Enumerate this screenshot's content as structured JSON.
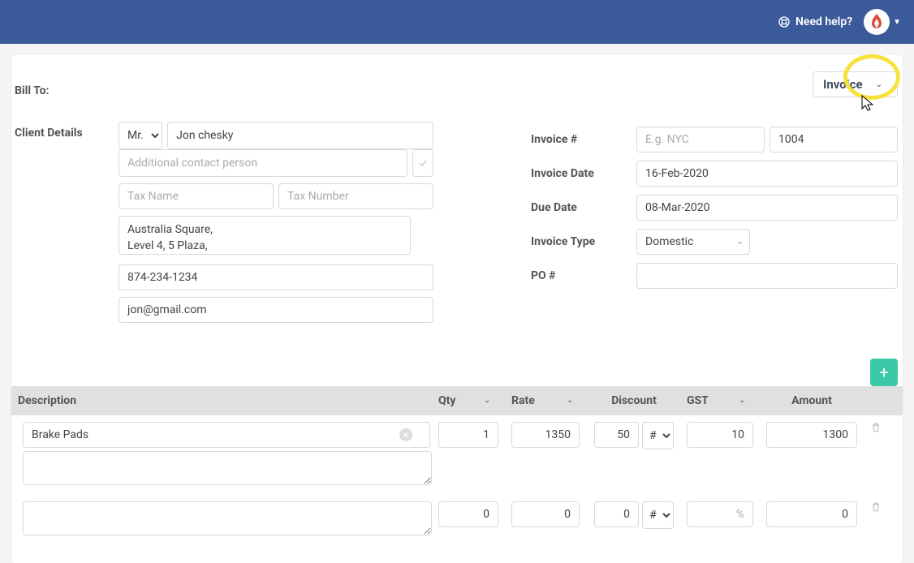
{
  "header": {
    "help_label": "Need help?"
  },
  "invoice_dropdown": {
    "label": "Invoice"
  },
  "labels": {
    "bill_to": "Bill To:",
    "client_details": "Client Details",
    "invoice_num": "Invoice #",
    "invoice_date": "Invoice Date",
    "due_date": "Due Date",
    "invoice_type": "Invoice Type",
    "po_num": "PO #"
  },
  "client": {
    "salutation": "Mr.",
    "name": "Jon chesky",
    "addl_contact_placeholder": "Additional contact person",
    "tax_name_placeholder": "Tax Name",
    "tax_number_placeholder": "Tax Number",
    "address": "Australia Square,\nLevel 4, 5 Plaza,",
    "phone": "874-234-1234",
    "email": "jon@gmail.com"
  },
  "invoice_meta": {
    "prefix_placeholder": "E.g. NYC",
    "number": "1004",
    "date": "16-Feb-2020",
    "due": "08-Mar-2020",
    "type": "Domestic",
    "po": ""
  },
  "columns": {
    "description": "Description",
    "qty": "Qty",
    "rate": "Rate",
    "discount": "Discount",
    "gst": "GST",
    "amount": "Amount"
  },
  "items": [
    {
      "description": "Brake Pads",
      "qty": "1",
      "rate": "1350",
      "discount_value": "50",
      "discount_unit": "#",
      "gst": "10",
      "amount": "1300"
    },
    {
      "description": "",
      "qty": "0",
      "rate": "0",
      "discount_value": "0",
      "discount_unit": "#",
      "gst": "%",
      "amount": "0"
    }
  ]
}
